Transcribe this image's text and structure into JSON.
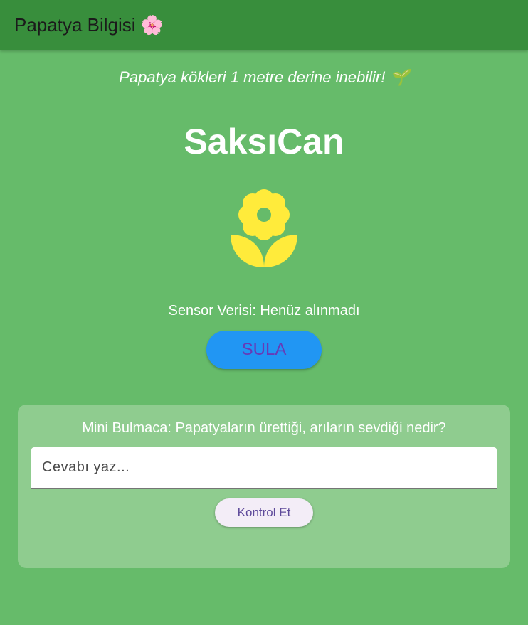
{
  "appbar": {
    "title": "Papatya Bilgisi 🌸"
  },
  "main": {
    "fact": "Papatya kökleri 1 metre derine inebilir! 🌱",
    "app_name": "SaksıCan",
    "flower_icon": "local-florist-icon",
    "sensor_text": "Sensor Verisi: Henüz alınmadı",
    "water_button_label": "SULA"
  },
  "puzzle": {
    "question": "Mini Bulmaca: Papatyaların ürettiği, arıların sevdiği nedir?",
    "input_value": "",
    "input_placeholder": "Cevabı yaz...",
    "check_button_label": "Kontrol Et"
  },
  "colors": {
    "background": "#66bb6a",
    "appbar": "#388e3c",
    "card": "#8fcc8f",
    "flower": "#ffeb3b",
    "water_button": "#2196f3",
    "water_button_text": "#673ab7"
  }
}
